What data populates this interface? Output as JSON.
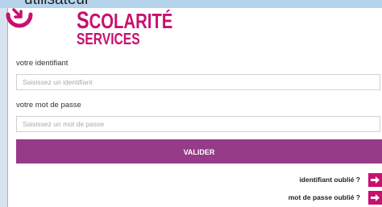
{
  "top_strip": {
    "text": "utilisateur"
  },
  "brand": {
    "line1_initial": "S",
    "line1_rest": "COLARITÉ",
    "line2": "SERVICES",
    "colors": {
      "brand": "#c8106e",
      "button": "#953b87"
    }
  },
  "form": {
    "id_label": "votre identifiant",
    "id_placeholder": "Saisissez un identifiant",
    "password_label": "votre mot de passe",
    "password_placeholder": "Saisissez un mot de passe",
    "submit_label": "VALIDER"
  },
  "links": {
    "forgot_id": "identifiant oublié ?",
    "forgot_password": "mot de passe oublié ?",
    "arrow_icon": "arrow-right-icon"
  }
}
